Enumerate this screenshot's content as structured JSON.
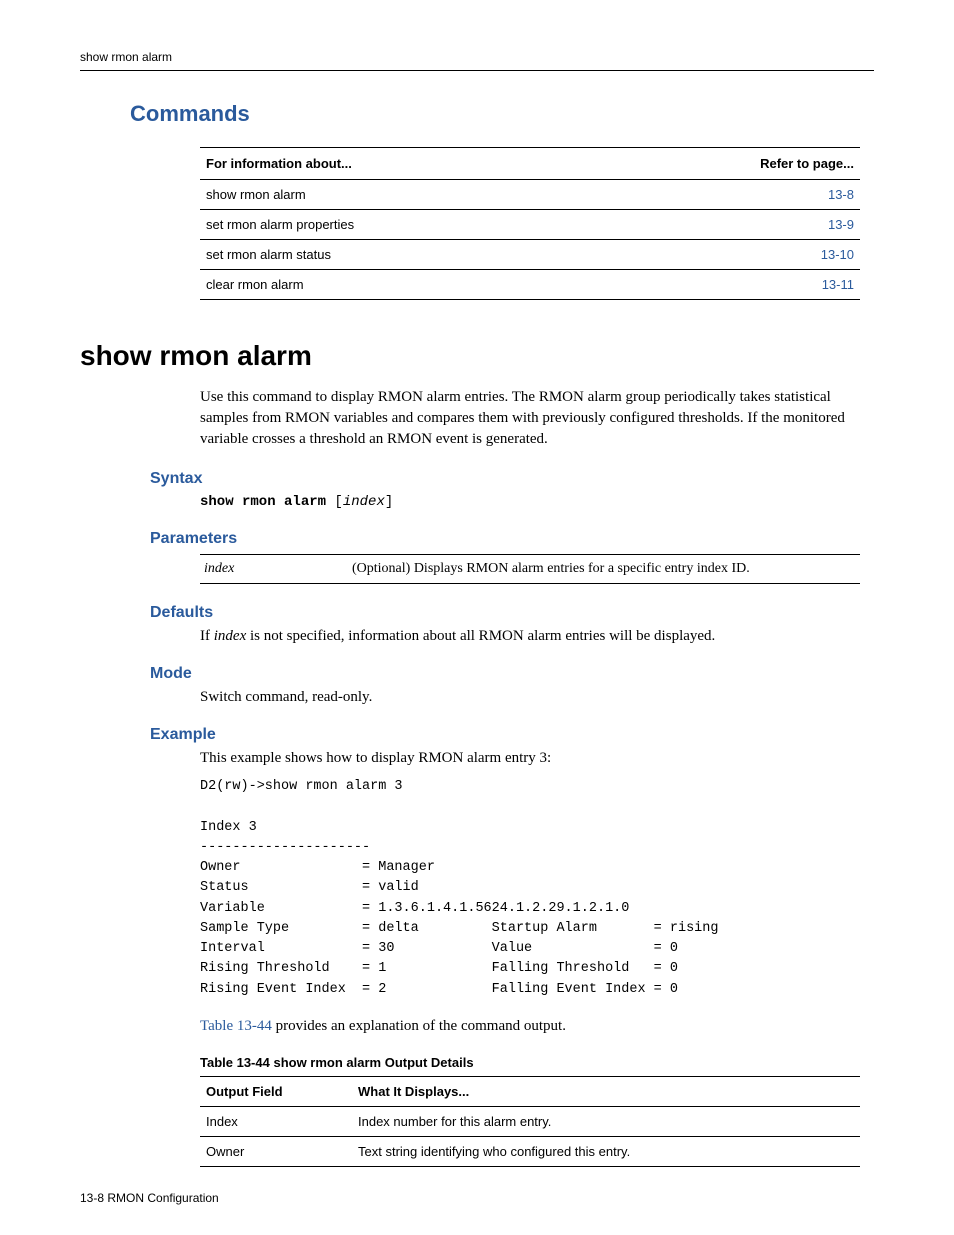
{
  "running_head": "show rmon alarm",
  "commands": {
    "heading": "Commands",
    "col1": "For information about...",
    "col2": "Refer to page...",
    "rows": [
      {
        "name": "show rmon alarm",
        "page": "13-8"
      },
      {
        "name": "set rmon alarm properties",
        "page": "13-9"
      },
      {
        "name": "set rmon alarm status",
        "page": "13-10"
      },
      {
        "name": "clear rmon alarm",
        "page": "13-11"
      }
    ]
  },
  "title": "show rmon alarm",
  "description": "Use this command to display RMON alarm entries. The RMON alarm group periodically takes statistical samples from RMON variables and compares them with previously configured thresholds. If the monitored variable crosses a threshold an RMON event is generated.",
  "syntax": {
    "heading": "Syntax",
    "command": "show rmon alarm",
    "optional_open": " [",
    "param": "index",
    "optional_close": "]"
  },
  "parameters": {
    "heading": "Parameters",
    "rows": [
      {
        "name": "index",
        "desc": "(Optional) Displays RMON alarm entries for a specific entry index ID."
      }
    ]
  },
  "defaults": {
    "heading": "Defaults",
    "pre": "If ",
    "em": "index",
    "post": " is not specified, information about all RMON alarm entries will be displayed."
  },
  "mode": {
    "heading": "Mode",
    "text": "Switch command, read-only."
  },
  "example": {
    "heading": "Example",
    "intro": "This example shows how to display RMON alarm entry 3:",
    "pre": "D2(rw)->show rmon alarm 3\n\nIndex 3\n---------------------\nOwner               = Manager\nStatus              = valid\nVariable            = 1.3.6.1.4.1.5624.1.2.29.1.2.1.0\nSample Type         = delta         Startup Alarm       = rising\nInterval            = 30            Value               = 0\nRising Threshold    = 1             Falling Threshold   = 0\nRising Event Index  = 2             Falling Event Index = 0",
    "after_link": "Table 13-44",
    "after_rest": " provides an explanation of the command output."
  },
  "output_table": {
    "caption": "Table 13-44   show rmon alarm Output Details",
    "col1": "Output Field",
    "col2": "What It Displays...",
    "rows": [
      {
        "field": "Index",
        "desc": "Index number for this alarm entry."
      },
      {
        "field": "Owner",
        "desc": "Text string identifying who configured this entry."
      }
    ]
  },
  "footer": "13-8   RMON Configuration"
}
